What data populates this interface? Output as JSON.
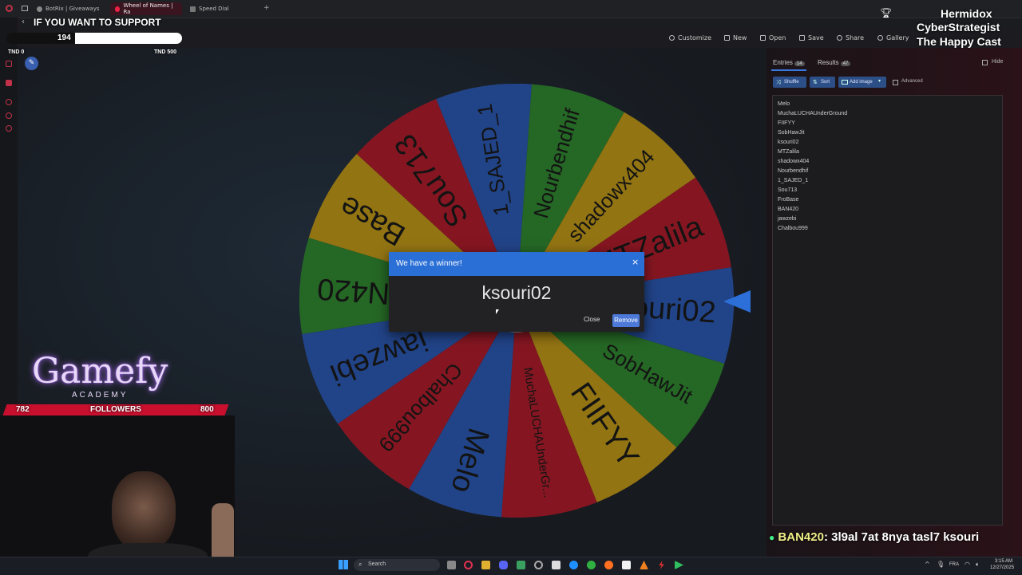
{
  "browser": {
    "tabs": [
      {
        "label": "BotRix | Giveaways",
        "active": false
      },
      {
        "label": "Wheel of Names | Ra",
        "active": true
      },
      {
        "label": "Speed Dial",
        "active": false
      }
    ],
    "new_tab": "+"
  },
  "overlay": {
    "support_label": "IF YOU WANT TO SUPPORT",
    "support_count": "194",
    "tnd_min": "TND 0",
    "tnd_max": "TND 500",
    "streamer": "Hermidox",
    "line2": "CyberStrategist",
    "line3": "The Happy Cast",
    "brand": "Gamefy",
    "brand_sub": "ACADEMY",
    "followers_label": "FOLLOWERS",
    "followers_current": "782",
    "followers_goal": "800",
    "chat_user": "BAN420",
    "chat_message": ": 3l9al 7at 8nya tasl7 ksouri"
  },
  "toolbar": {
    "customize": "Customize",
    "new": "New",
    "open": "Open",
    "save": "Save",
    "share": "Share",
    "gallery": "Gallery"
  },
  "wheel": {
    "segments": [
      {
        "name": "ksouri02",
        "color": "#3368d0"
      },
      {
        "name": "SobHawJit",
        "color": "#3a9e3a"
      },
      {
        "name": "FIIFYY",
        "color": "#e0b21e"
      },
      {
        "name": "MuchaLUCHAUnderGr...",
        "color": "#cc2233"
      },
      {
        "name": "Melo",
        "color": "#3368d0"
      },
      {
        "name": "Chalbou999",
        "color": "#cc2233"
      },
      {
        "name": "jawzebi",
        "color": "#3368d0"
      },
      {
        "name": "N420",
        "color": "#3a9e3a"
      },
      {
        "name": "Base",
        "color": "#e0b21e"
      },
      {
        "name": "Sou713",
        "color": "#cc2233"
      },
      {
        "name": "1_SAJED_1",
        "color": "#3368d0"
      },
      {
        "name": "Nourbendhif",
        "color": "#3a9e3a"
      },
      {
        "name": "shadowx404",
        "color": "#e0b21e"
      },
      {
        "name": "MTZalila",
        "color": "#cc2233"
      }
    ]
  },
  "dialog": {
    "title": "We have a winner!",
    "close_x": "×",
    "winner": "ksouri02",
    "close_label": "Close",
    "remove_label": "Remove"
  },
  "panel": {
    "entries_tab": "Entries",
    "entries_count": "14",
    "results_tab": "Results",
    "results_count": "47",
    "hide_label": "Hide",
    "shuffle": "Shuffle",
    "sort": "Sort",
    "add_image": "Add image",
    "advanced": "Advanced",
    "entries": [
      "Melo",
      "MuchaLUCHAUnderGround",
      "FIIFYY",
      "SobHawJit",
      "ksouri02",
      "MTZalila",
      "shadowx404",
      "Nourbendhif",
      "1_SAJED_1",
      "Sou713",
      "FroBase",
      "BAN420",
      "jawzebi",
      "Chalbou999"
    ]
  },
  "taskbar": {
    "search": "Search",
    "lang": "FRA",
    "time": "3:15 AM",
    "date": "12/27/2025"
  }
}
